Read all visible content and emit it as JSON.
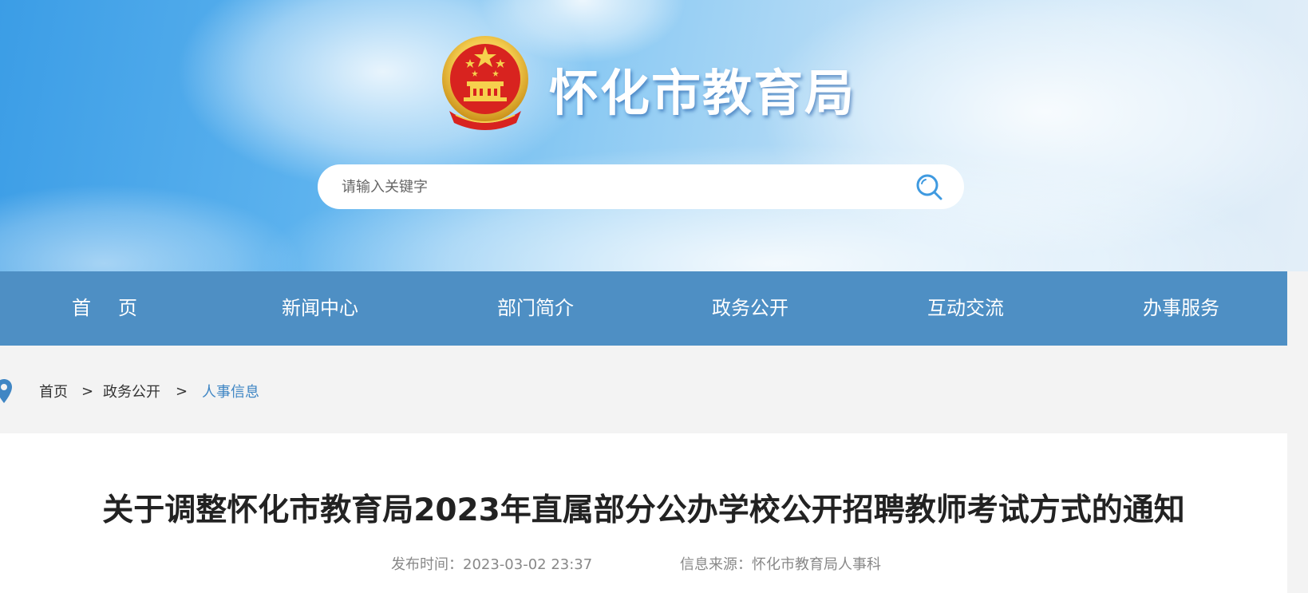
{
  "header": {
    "site_title": "怀化市教育局",
    "search": {
      "placeholder": "请输入关键字",
      "value": ""
    }
  },
  "nav": {
    "items": [
      {
        "label": "首页"
      },
      {
        "label": "新闻中心"
      },
      {
        "label": "部门简介"
      },
      {
        "label": "政务公开"
      },
      {
        "label": "互动交流"
      },
      {
        "label": "办事服务"
      }
    ]
  },
  "breadcrumb": {
    "items": [
      "首页",
      "政务公开",
      "人事信息"
    ],
    "separator": ">"
  },
  "article": {
    "title": "关于调整怀化市教育局2023年直属部分公办学校公开招聘教师考试方式的通知",
    "publish_time": "发布时间：2023-03-02 23:37",
    "source": "信息来源：怀化市教育局人事科"
  },
  "colors": {
    "nav_bg": "#4e8fc4",
    "breadcrumb_active": "#3f86c4",
    "search_icon": "#3f9ae0",
    "title_text": "#222222"
  }
}
